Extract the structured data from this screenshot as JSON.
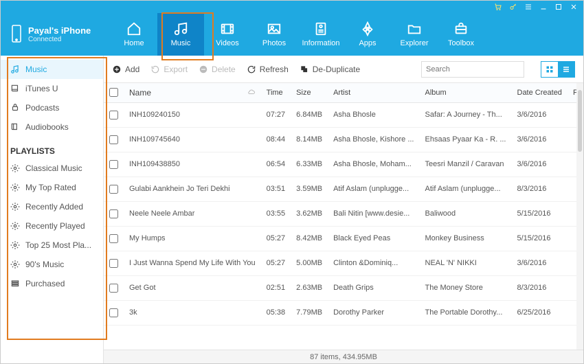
{
  "device": {
    "name": "Payal's iPhone",
    "status": "Connected"
  },
  "topnav": [
    "Home",
    "Music",
    "Videos",
    "Photos",
    "Information",
    "Apps",
    "Explorer",
    "Toolbox"
  ],
  "sidebar": {
    "library": [
      {
        "label": "Music"
      },
      {
        "label": "iTunes U"
      },
      {
        "label": "Podcasts"
      },
      {
        "label": "Audiobooks"
      }
    ],
    "playlists_title": "PLAYLISTS",
    "playlists": [
      {
        "label": "Classical Music"
      },
      {
        "label": "My Top Rated"
      },
      {
        "label": "Recently Added"
      },
      {
        "label": "Recently Played"
      },
      {
        "label": "Top 25 Most Pla..."
      },
      {
        "label": "90's Music"
      },
      {
        "label": "Purchased"
      }
    ]
  },
  "toolbar": {
    "add": "Add",
    "export": "Export",
    "delete": "Delete",
    "refresh": "Refresh",
    "dedup": "De-Duplicate",
    "search_ph": "Search"
  },
  "columns": {
    "name": "Name",
    "time": "Time",
    "size": "Size",
    "artist": "Artist",
    "album": "Album",
    "date": "Date Created",
    "fix": "Fix"
  },
  "rows": [
    {
      "name": "INH109240150",
      "time": "07:27",
      "size": "6.84MB",
      "artist": "Asha Bhosle",
      "album": "Safar: A Journey - Th...",
      "date": "3/6/2016"
    },
    {
      "name": "INH109745640",
      "time": "08:44",
      "size": "8.14MB",
      "artist": "Asha Bhosle, Kishore ...",
      "album": "Ehsaas Pyaar Ka - R. ...",
      "date": "3/6/2016"
    },
    {
      "name": "INH109438850",
      "time": "06:54",
      "size": "6.33MB",
      "artist": "Asha Bhosle, Moham...",
      "album": "Teesri Manzil / Caravan",
      "date": "3/6/2016"
    },
    {
      "name": "Gulabi Aankhein Jo Teri Dekhi",
      "time": "03:51",
      "size": "3.59MB",
      "artist": "Atif Aslam (unplugge...",
      "album": "Atif Aslam (unplugge...",
      "date": "8/3/2016"
    },
    {
      "name": "Neele Neele Ambar",
      "time": "03:55",
      "size": "3.62MB",
      "artist": "Bali Nitin [www.desie...",
      "album": "Baliwood",
      "date": "5/15/2016"
    },
    {
      "name": "My Humps",
      "time": "05:27",
      "size": "8.42MB",
      "artist": "Black Eyed Peas",
      "album": "Monkey Business",
      "date": "5/15/2016"
    },
    {
      "name": "I Just Wanna Spend My Life With You",
      "time": "05:27",
      "size": "5.00MB",
      "artist": "Clinton &amp;Dominiq...",
      "album": "NEAL 'N' NIKKI",
      "date": "3/6/2016"
    },
    {
      "name": "Get Got",
      "time": "02:51",
      "size": "2.63MB",
      "artist": "Death Grips",
      "album": "The Money Store",
      "date": "8/3/2016"
    },
    {
      "name": "3k",
      "time": "05:38",
      "size": "7.79MB",
      "artist": "Dorothy Parker",
      "album": "The Portable Dorothy...",
      "date": "6/25/2016"
    }
  ],
  "footer": "87 items, 434.95MB"
}
